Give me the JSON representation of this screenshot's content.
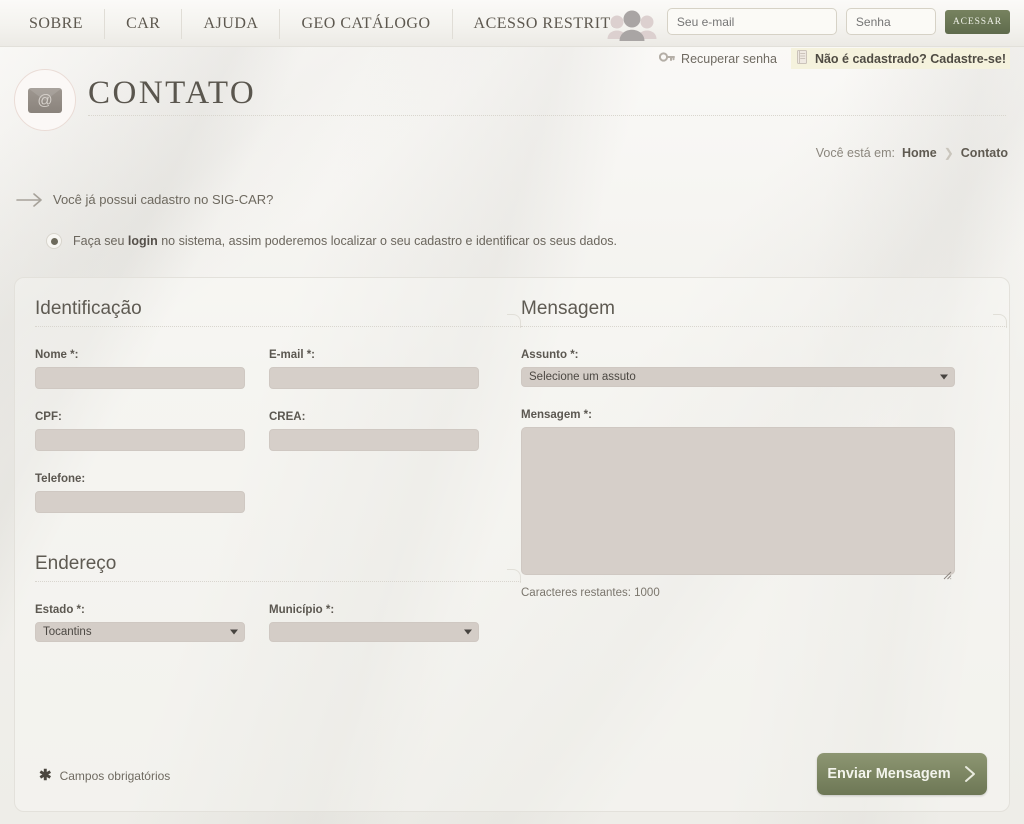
{
  "nav": {
    "items": [
      {
        "label": "SOBRE",
        "name": "nav-sobre"
      },
      {
        "label": "CAR",
        "name": "nav-car"
      },
      {
        "label": "AJUDA",
        "name": "nav-ajuda"
      },
      {
        "label": "GEO CATÁLOGO",
        "name": "nav-geo-catalogo"
      },
      {
        "label": "ACESSO RESTRITO",
        "name": "nav-acesso-restrito"
      }
    ]
  },
  "login": {
    "email_placeholder": "Seu e-mail",
    "email_value": "",
    "password_placeholder": "Senha",
    "password_value": "",
    "submit_label": "ACESSAR",
    "recover_label": "Recuperar senha",
    "register_label": "Não é cadastrado? Cadastre-se!",
    "accent_green": "#6b7554"
  },
  "header": {
    "title": "CONTATO",
    "icon_glyph": "@"
  },
  "breadcrumb": {
    "prefix": "Você está em:",
    "home": "Home",
    "separator": "❯",
    "current": "Contato"
  },
  "prompt": {
    "question": "Você já possui cadastro no SIG-CAR?",
    "option_pre": "Faça seu ",
    "option_bold": "login",
    "option_post": " no sistema, assim poderemos localizar o seu cadastro e identificar os seus dados."
  },
  "form": {
    "identification": {
      "heading": "Identificação",
      "nome_label": "Nome *:",
      "nome_value": "",
      "email_label": "E-mail *:",
      "email_value": "",
      "cpf_label": "CPF:",
      "cpf_value": "",
      "crea_label": "CREA:",
      "crea_value": "",
      "telefone_label": "Telefone:",
      "telefone_value": ""
    },
    "address": {
      "heading": "Endereço",
      "estado_label": "Estado *:",
      "estado_value": "Tocantins",
      "municipio_label": "Município *:",
      "municipio_value": ""
    },
    "message": {
      "heading": "Mensagem",
      "assunto_label": "Assunto *:",
      "assunto_value": "Selecione um assuto",
      "mensagem_label": "Mensagem *:",
      "mensagem_value": "",
      "char_count": "Caracteres restantes: 1000"
    },
    "footer": {
      "required_star": "✱",
      "required_note": "Campos obrigatórios",
      "submit_label": "Enviar Mensagem"
    }
  }
}
